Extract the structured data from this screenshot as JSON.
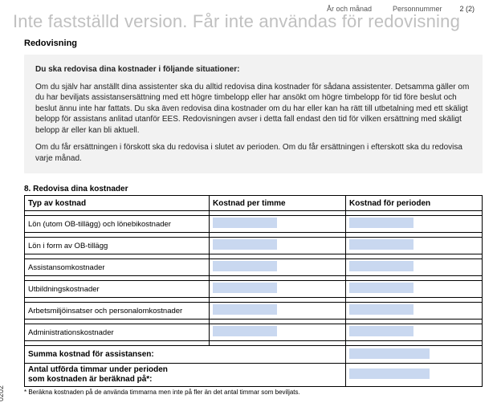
{
  "meta": {
    "year_month_label": "År och månad",
    "personnr_label": "Personnummer",
    "page_label": "2 (2)"
  },
  "watermark": "Inte fastställd version. Får inte användas för redovisning",
  "section_title": "Redovisning",
  "info": {
    "p1": "Du ska redovisa dina kostnader i följande situationer:",
    "p2": "Om du själv har anställt dina assistenter ska du alltid redovisa dina kostnader för sådana assistenter. Detsamma gäller om du har beviljats assistansersättning med ett högre timbelopp eller har ansökt om högre timbelopp för tid före beslut och beslut ännu inte har fattats. Du ska även redovisa dina kostnader om du har eller kan ha rätt till utbetalning med ett skäligt belopp för assistans anlitad utanför EES. Redovisningen avser i detta fall endast den tid för vilken ersättning med skäligt belopp är eller kan bli aktuell.",
    "p3": "Om du får ersättningen i förskott ska du redovisa i slutet av perioden. Om du får ersättningen i efterskott ska du redovisa varje månad."
  },
  "question8": {
    "title": "8. Redovisa dina kostnader",
    "col1": "Typ av kostnad",
    "col2": "Kostnad per timme",
    "col3": "Kostnad för perioden",
    "rows": [
      "Lön (utom OB-tillägg) och lönebikostnader",
      "Lön i form av OB-tillägg",
      "Assistansomkostnader",
      "Utbildningskostnader",
      "Arbetsmiljöinsatser och personalomkostnader",
      "Administrationskostnader"
    ],
    "sum_label": "Summa kostnad för assistansen:",
    "hours_label_1": "Antal utförda timmar under perioden",
    "hours_label_2": "som kostnaden är beräknad på*:",
    "footnote": "* Beräkna kostnaden på de använda timmarna men inte på fler än det antal timmar som beviljats."
  },
  "side_code": "0202"
}
